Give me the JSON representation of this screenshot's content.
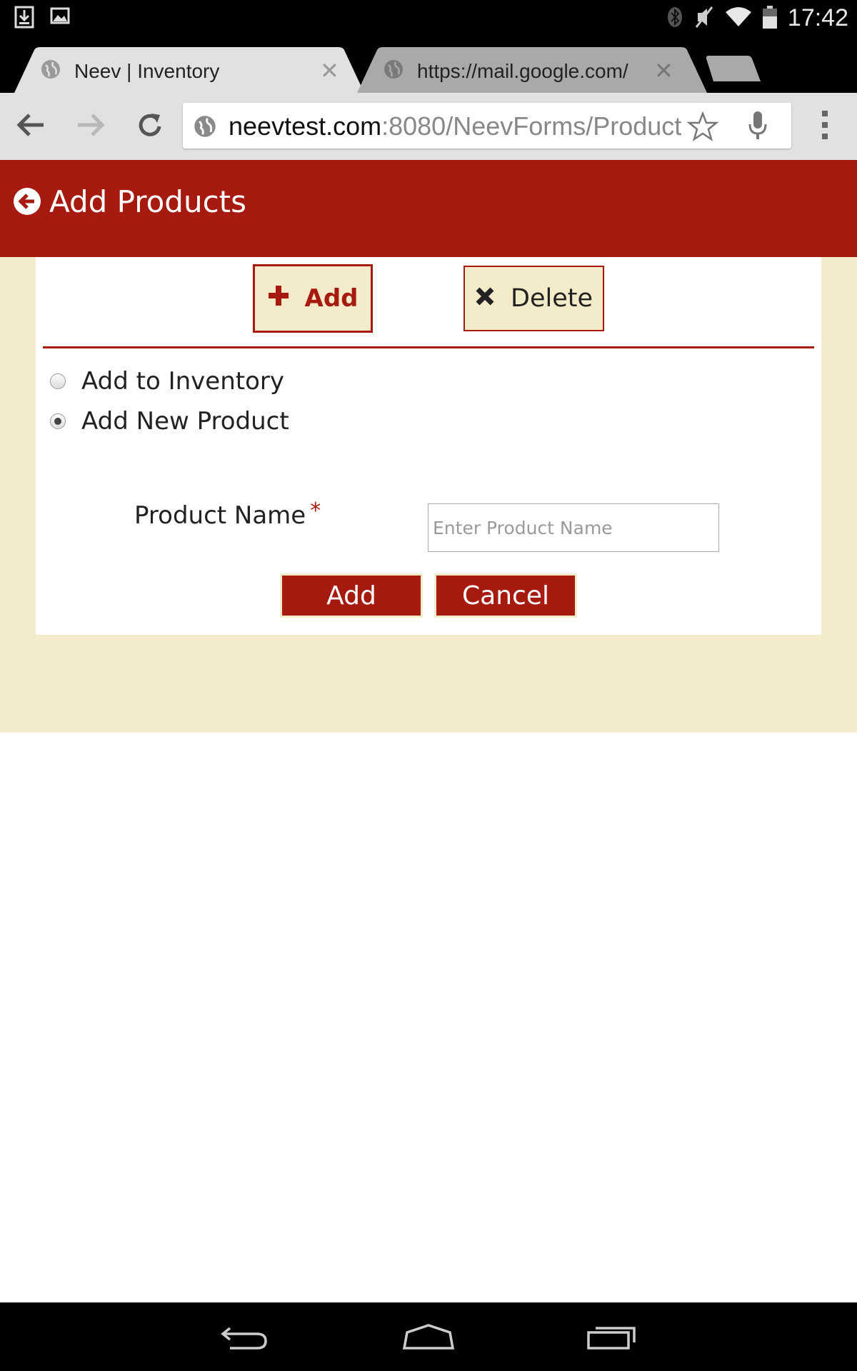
{
  "status_bar": {
    "time": "17:42",
    "left_icons": [
      "download-icon",
      "image-icon"
    ],
    "right_icons": [
      "bluetooth-icon",
      "vibrate-off-icon",
      "wifi-icon",
      "battery-icon"
    ]
  },
  "tabs": [
    {
      "title": "Neev | Inventory",
      "active": true
    },
    {
      "title": "https://mail.google.com/",
      "active": false
    }
  ],
  "omnibox": {
    "host": "neevtest.com",
    "rest": ":8080/NeevForms/Product"
  },
  "header": {
    "title": "Add Products"
  },
  "toggle": {
    "add_label": "Add",
    "delete_label": "Delete"
  },
  "mode_options": [
    {
      "label": "Add to Inventory",
      "selected": false
    },
    {
      "label": "Add New Product",
      "selected": true
    }
  ],
  "form": {
    "product_name_label": "Product Name",
    "required_marker": "*",
    "product_name_placeholder": "Enter Product Name",
    "product_name_value": "",
    "add_button": "Add",
    "cancel_button": "Cancel"
  },
  "colors": {
    "brand_red": "#a61a10",
    "cream": "#f4ebcb"
  }
}
